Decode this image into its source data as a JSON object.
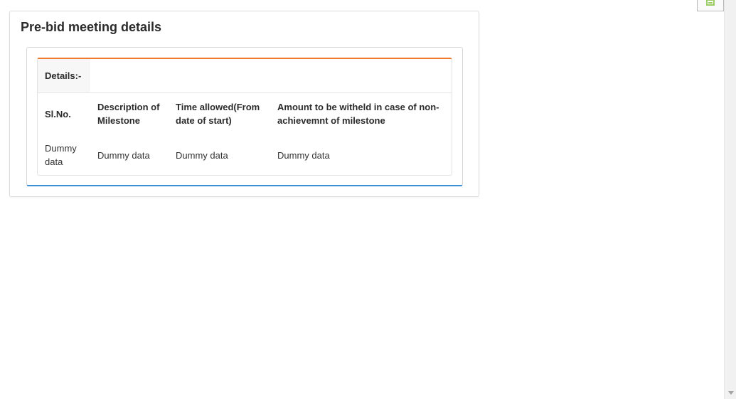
{
  "page": {
    "title": "Pre-bid meeting details"
  },
  "details": {
    "label": "Details:-",
    "accent_top": "#f07a2e",
    "accent_bottom": "#3d8fd6"
  },
  "table": {
    "columns": [
      "Sl.No.",
      "Description of Milestone",
      "Time allowed(From date of start)",
      "Amount to be witheld in case of non-achievemnt of milestone"
    ],
    "rows": [
      [
        "Dummy data",
        "Dummy data",
        "Dummy data",
        "Dummy data"
      ]
    ]
  }
}
